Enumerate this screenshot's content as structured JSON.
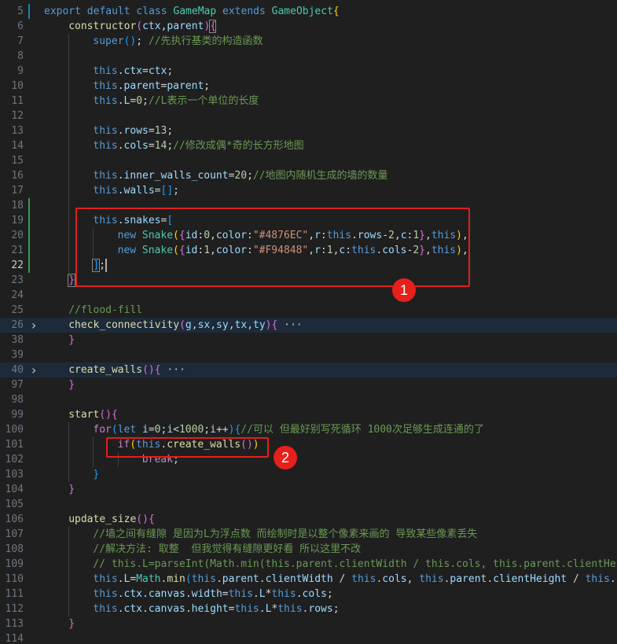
{
  "editor": {
    "current_line": "22",
    "lines": [
      {
        "num": "5",
        "tokens": [
          [
            "kw",
            "export "
          ],
          [
            "kw",
            "default "
          ],
          [
            "kw",
            "class "
          ],
          [
            "cls",
            "GameMap "
          ],
          [
            "kw",
            "extends "
          ],
          [
            "cls",
            "GameObject"
          ],
          [
            "br1",
            "{"
          ]
        ]
      },
      {
        "num": "6",
        "tokens": [
          [
            "fn",
            "constructor"
          ],
          [
            "br2",
            "("
          ],
          [
            "prop",
            "ctx"
          ],
          [
            "",
            ","
          ],
          [
            "prop",
            "parent"
          ],
          [
            "br2",
            ")"
          ],
          [
            "br2",
            "{"
          ]
        ]
      },
      {
        "num": "7",
        "tokens": [
          [
            "kw",
            "super"
          ],
          [
            "br3",
            "()"
          ],
          [
            "",
            "; "
          ],
          [
            "cmt",
            "//先执行基类的构造函数"
          ]
        ]
      },
      {
        "num": "8",
        "tokens": []
      },
      {
        "num": "9",
        "tokens": [
          [
            "kw",
            "this"
          ],
          [
            "",
            "."
          ],
          [
            "prop",
            "ctx"
          ],
          [
            "",
            "="
          ],
          [
            "prop",
            "ctx"
          ],
          [
            "",
            ";"
          ]
        ]
      },
      {
        "num": "10",
        "tokens": [
          [
            "kw",
            "this"
          ],
          [
            "",
            "."
          ],
          [
            "prop",
            "parent"
          ],
          [
            "",
            "="
          ],
          [
            "prop",
            "parent"
          ],
          [
            "",
            ";"
          ]
        ]
      },
      {
        "num": "11",
        "tokens": [
          [
            "kw",
            "this"
          ],
          [
            "",
            "."
          ],
          [
            "prop",
            "L"
          ],
          [
            "",
            "="
          ],
          [
            "num",
            "0"
          ],
          [
            "",
            ";"
          ],
          [
            "cmt",
            "//L表示一个单位的长度"
          ]
        ]
      },
      {
        "num": "12",
        "tokens": []
      },
      {
        "num": "13",
        "tokens": [
          [
            "kw",
            "this"
          ],
          [
            "",
            "."
          ],
          [
            "prop",
            "rows"
          ],
          [
            "",
            "="
          ],
          [
            "num",
            "13"
          ],
          [
            "",
            ";"
          ]
        ]
      },
      {
        "num": "14",
        "tokens": [
          [
            "kw",
            "this"
          ],
          [
            "",
            "."
          ],
          [
            "prop",
            "cols"
          ],
          [
            "",
            "="
          ],
          [
            "num",
            "14"
          ],
          [
            "",
            ";"
          ],
          [
            "cmt",
            "//修改成偶*奇的长方形地图"
          ]
        ]
      },
      {
        "num": "15",
        "tokens": []
      },
      {
        "num": "16",
        "tokens": [
          [
            "kw",
            "this"
          ],
          [
            "",
            "."
          ],
          [
            "prop",
            "inner_walls_count"
          ],
          [
            "",
            "="
          ],
          [
            "num",
            "20"
          ],
          [
            "",
            ";"
          ],
          [
            "cmt",
            "//地图内随机生成的墙的数量"
          ]
        ]
      },
      {
        "num": "17",
        "tokens": [
          [
            "kw",
            "this"
          ],
          [
            "",
            "."
          ],
          [
            "prop",
            "walls"
          ],
          [
            "",
            "="
          ],
          [
            "br3",
            "[]"
          ],
          [
            "",
            ";"
          ]
        ]
      },
      {
        "num": "18",
        "tokens": []
      },
      {
        "num": "19",
        "tokens": [
          [
            "kw",
            "this"
          ],
          [
            "",
            "."
          ],
          [
            "prop",
            "snakes"
          ],
          [
            "",
            "="
          ],
          [
            "br3",
            "["
          ]
        ]
      },
      {
        "num": "20",
        "tokens": [
          [
            "kw",
            "new "
          ],
          [
            "cls",
            "Snake"
          ],
          [
            "br1",
            "("
          ],
          [
            "br2",
            "{"
          ],
          [
            "prop",
            "id"
          ],
          [
            "",
            ":"
          ],
          [
            "num",
            "0"
          ],
          [
            "",
            ","
          ],
          [
            "prop",
            "color"
          ],
          [
            "",
            ":"
          ],
          [
            "str",
            "\"#4876EC\""
          ],
          [
            "",
            ","
          ],
          [
            "prop",
            "r"
          ],
          [
            "",
            ":"
          ],
          [
            "kw",
            "this"
          ],
          [
            "",
            "."
          ],
          [
            "prop",
            "rows"
          ],
          [
            "",
            "-"
          ],
          [
            "num",
            "2"
          ],
          [
            "",
            ","
          ],
          [
            "prop",
            "c"
          ],
          [
            "",
            ":"
          ],
          [
            "num",
            "1"
          ],
          [
            "br2",
            "}"
          ],
          [
            "",
            ","
          ],
          [
            "kw",
            "this"
          ],
          [
            "br1",
            ")"
          ],
          [
            "",
            ","
          ]
        ]
      },
      {
        "num": "21",
        "tokens": [
          [
            "kw",
            "new "
          ],
          [
            "cls",
            "Snake"
          ],
          [
            "br1",
            "("
          ],
          [
            "br2",
            "{"
          ],
          [
            "prop",
            "id"
          ],
          [
            "",
            ":"
          ],
          [
            "num",
            "1"
          ],
          [
            "",
            ","
          ],
          [
            "prop",
            "color"
          ],
          [
            "",
            ":"
          ],
          [
            "str",
            "\"#F94848\""
          ],
          [
            "",
            ","
          ],
          [
            "prop",
            "r"
          ],
          [
            "",
            ":"
          ],
          [
            "num",
            "1"
          ],
          [
            "",
            ","
          ],
          [
            "prop",
            "c"
          ],
          [
            "",
            ":"
          ],
          [
            "kw",
            "this"
          ],
          [
            "",
            "."
          ],
          [
            "prop",
            "cols"
          ],
          [
            "",
            "-"
          ],
          [
            "num",
            "2"
          ],
          [
            "br2",
            "}"
          ],
          [
            "",
            ","
          ],
          [
            "kw",
            "this"
          ],
          [
            "br1",
            ")"
          ],
          [
            "",
            ","
          ]
        ]
      },
      {
        "num": "22",
        "tokens": [
          [
            "br3",
            "]"
          ],
          [
            "",
            ";"
          ]
        ]
      },
      {
        "num": "23",
        "tokens": [
          [
            "br2",
            "}"
          ]
        ]
      },
      {
        "num": "24",
        "tokens": []
      },
      {
        "num": "25",
        "tokens": [
          [
            "cmt",
            "//flood-fill"
          ]
        ]
      },
      {
        "num": "26",
        "tokens": [
          [
            "fn",
            "check_connectivity"
          ],
          [
            "br2",
            "("
          ],
          [
            "prop",
            "g"
          ],
          [
            "",
            ","
          ],
          [
            "prop",
            "sx"
          ],
          [
            "",
            ","
          ],
          [
            "prop",
            "sy"
          ],
          [
            "",
            ","
          ],
          [
            "prop",
            "tx"
          ],
          [
            "",
            ","
          ],
          [
            "prop",
            "ty"
          ],
          [
            "br2",
            ")"
          ],
          [
            "br2",
            "{"
          ],
          [
            "ell",
            " ···"
          ]
        ]
      },
      {
        "num": "38",
        "tokens": [
          [
            "br2",
            "}"
          ]
        ]
      },
      {
        "num": "39",
        "tokens": []
      },
      {
        "num": "40",
        "tokens": [
          [
            "fn",
            "create_walls"
          ],
          [
            "br2",
            "()"
          ],
          [
            "br2",
            "{"
          ],
          [
            "ell",
            " ···"
          ]
        ]
      },
      {
        "num": "97",
        "tokens": [
          [
            "br2",
            "}"
          ]
        ]
      },
      {
        "num": "98",
        "tokens": []
      },
      {
        "num": "99",
        "tokens": [
          [
            "fn",
            "start"
          ],
          [
            "br2",
            "()"
          ],
          [
            "br2",
            "{"
          ]
        ]
      },
      {
        "num": "100",
        "tokens": [
          [
            "ctl",
            "for"
          ],
          [
            "br3",
            "("
          ],
          [
            "kw",
            "let "
          ],
          [
            "prop",
            "i"
          ],
          [
            "",
            "="
          ],
          [
            "num",
            "0"
          ],
          [
            "",
            ";"
          ],
          [
            "prop",
            "i"
          ],
          [
            "",
            "<"
          ],
          [
            "num",
            "1000"
          ],
          [
            "",
            ";"
          ],
          [
            "prop",
            "i"
          ],
          [
            "",
            "++"
          ],
          [
            "br3",
            ")"
          ],
          [
            "br3",
            "{"
          ],
          [
            "cmt",
            "//可以 但最好别写死循环 1000次足够生成连通的了"
          ]
        ]
      },
      {
        "num": "101",
        "tokens": [
          [
            "ctl",
            "if"
          ],
          [
            "br1",
            "("
          ],
          [
            "kw",
            "this"
          ],
          [
            "",
            "."
          ],
          [
            "fn",
            "create_walls"
          ],
          [
            "br2",
            "()"
          ],
          [
            "br1",
            ")"
          ]
        ]
      },
      {
        "num": "102",
        "tokens": [
          [
            "ctl",
            "break"
          ],
          [
            "",
            ";"
          ]
        ]
      },
      {
        "num": "103",
        "tokens": [
          [
            "br3",
            "}"
          ]
        ]
      },
      {
        "num": "104",
        "tokens": [
          [
            "br2",
            "}"
          ]
        ]
      },
      {
        "num": "105",
        "tokens": []
      },
      {
        "num": "106",
        "tokens": [
          [
            "fn",
            "update_size"
          ],
          [
            "br2",
            "()"
          ],
          [
            "br2",
            "{"
          ]
        ]
      },
      {
        "num": "107",
        "tokens": [
          [
            "cmt",
            "//墙之间有缝隙 是因为L为浮点数 而绘制时是以整个像素来画的 导致某些像素丢失"
          ]
        ]
      },
      {
        "num": "108",
        "tokens": [
          [
            "cmt",
            "//解决方法: 取整  但我觉得有缝隙更好看 所以这里不改"
          ]
        ]
      },
      {
        "num": "109",
        "tokens": [
          [
            "cmt",
            "// this.L=parseInt(Math.min(this.parent.clientWidth / this.cols, this.parent.clientHeight / this.rows));"
          ]
        ]
      },
      {
        "num": "110",
        "tokens": [
          [
            "kw",
            "this"
          ],
          [
            "",
            "."
          ],
          [
            "prop",
            "L"
          ],
          [
            "",
            "="
          ],
          [
            "cls",
            "Math"
          ],
          [
            "",
            "."
          ],
          [
            "fn",
            "min"
          ],
          [
            "br3",
            "("
          ],
          [
            "kw",
            "this"
          ],
          [
            "",
            "."
          ],
          [
            "prop",
            "parent"
          ],
          [
            "",
            "."
          ],
          [
            "prop",
            "clientWidth"
          ],
          [
            "",
            " / "
          ],
          [
            "kw",
            "this"
          ],
          [
            "",
            "."
          ],
          [
            "prop",
            "cols"
          ],
          [
            "",
            ", "
          ],
          [
            "kw",
            "this"
          ],
          [
            "",
            "."
          ],
          [
            "prop",
            "parent"
          ],
          [
            "",
            "."
          ],
          [
            "prop",
            "clientHeight"
          ],
          [
            "",
            " / "
          ],
          [
            "kw",
            "this"
          ],
          [
            "",
            "."
          ],
          [
            "prop",
            "rows"
          ],
          [
            "br3",
            ")"
          ],
          [
            "",
            ";"
          ]
        ]
      },
      {
        "num": "111",
        "tokens": [
          [
            "kw",
            "this"
          ],
          [
            "",
            "."
          ],
          [
            "prop",
            "ctx"
          ],
          [
            "",
            "."
          ],
          [
            "prop",
            "canvas"
          ],
          [
            "",
            "."
          ],
          [
            "prop",
            "width"
          ],
          [
            "",
            "="
          ],
          [
            "kw",
            "this"
          ],
          [
            "",
            "."
          ],
          [
            "prop",
            "L"
          ],
          [
            "",
            "*"
          ],
          [
            "kw",
            "this"
          ],
          [
            "",
            "."
          ],
          [
            "prop",
            "cols"
          ],
          [
            "",
            ";"
          ]
        ]
      },
      {
        "num": "112",
        "tokens": [
          [
            "kw",
            "this"
          ],
          [
            "",
            "."
          ],
          [
            "prop",
            "ctx"
          ],
          [
            "",
            "."
          ],
          [
            "prop",
            "canvas"
          ],
          [
            "",
            "."
          ],
          [
            "prop",
            "height"
          ],
          [
            "",
            "="
          ],
          [
            "kw",
            "this"
          ],
          [
            "",
            "."
          ],
          [
            "prop",
            "L"
          ],
          [
            "",
            "*"
          ],
          [
            "kw",
            "this"
          ],
          [
            "",
            "."
          ],
          [
            "prop",
            "rows"
          ],
          [
            "",
            ";"
          ]
        ]
      },
      {
        "num": "113",
        "tokens": [
          [
            "br2",
            "}"
          ]
        ]
      },
      {
        "num": "114",
        "tokens": []
      }
    ]
  },
  "annotations": [
    {
      "label": "1"
    },
    {
      "label": "2"
    }
  ]
}
